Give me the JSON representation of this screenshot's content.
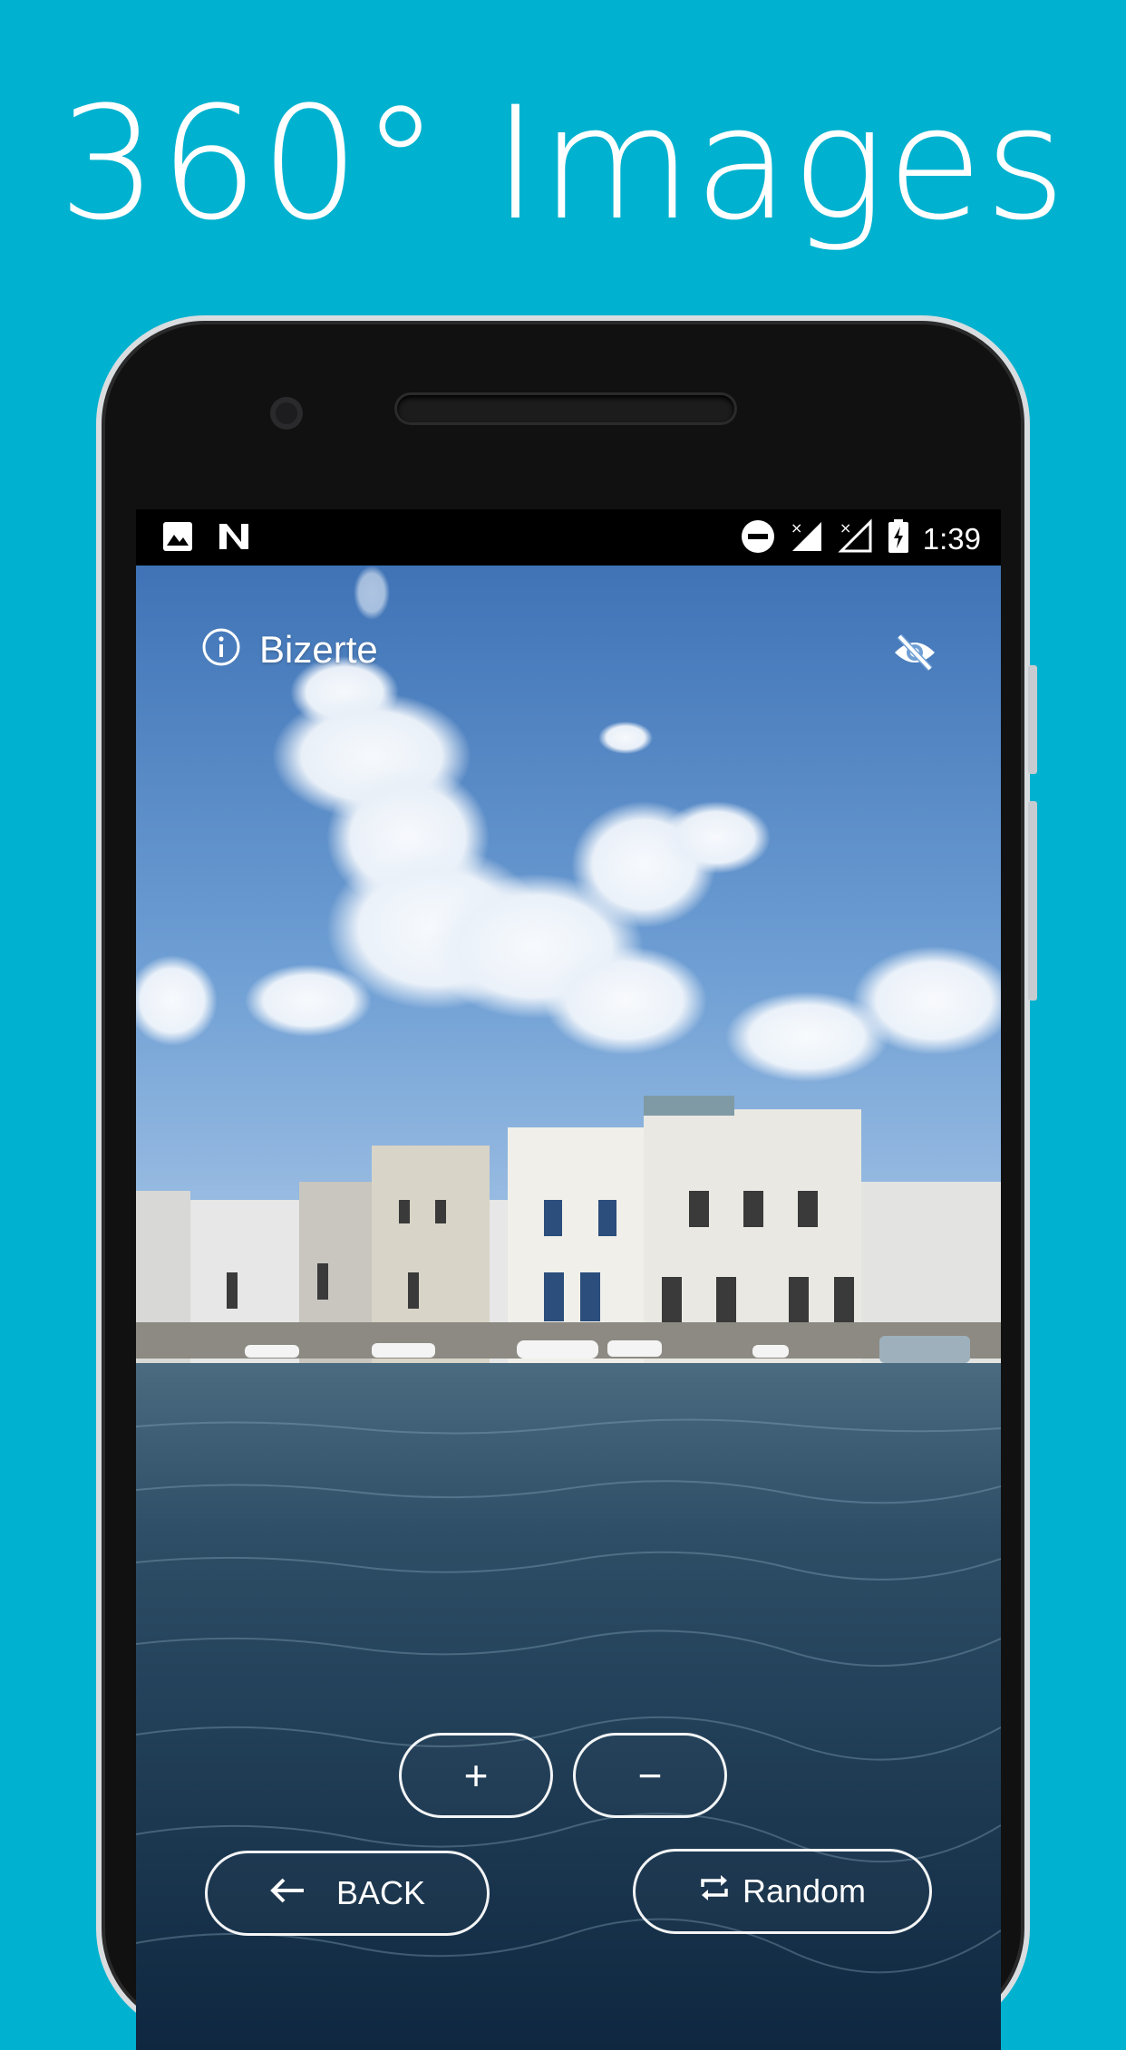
{
  "headline": "360° Images",
  "status_bar": {
    "time": "1:39",
    "left_icons": [
      "image-icon",
      "n-icon"
    ],
    "right_icons": [
      "dnd-icon",
      "signal-icon",
      "signal-x-icon",
      "battery-charging-icon"
    ]
  },
  "viewer": {
    "location": "Bizerte",
    "info_icon": "info-icon",
    "hide_ui_icon": "eye-off-icon",
    "zoom_in_label": "+",
    "zoom_out_label": "−",
    "back_label": "BACK",
    "random_label": "Random"
  },
  "colors": {
    "background": "#00b2cf",
    "phone_body": "#111111"
  }
}
